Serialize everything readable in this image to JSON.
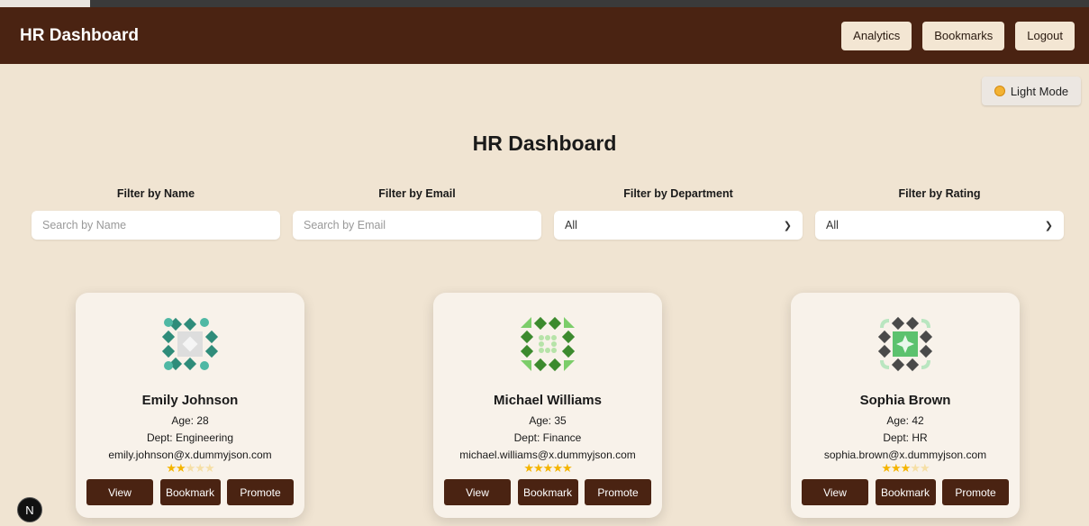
{
  "navbar": {
    "brand": "HR Dashboard",
    "analytics_label": "Analytics",
    "bookmarks_label": "Bookmarks",
    "logout_label": "Logout"
  },
  "theme_toggle": {
    "label": "Light Mode",
    "icon": "sun-icon"
  },
  "page_title": "HR Dashboard",
  "filters": {
    "name": {
      "label": "Filter by Name",
      "placeholder": "Search by Name"
    },
    "email": {
      "label": "Filter by Email",
      "placeholder": "Search by Email"
    },
    "department": {
      "label": "Filter by Department",
      "value": "All"
    },
    "rating": {
      "label": "Filter by Rating",
      "value": "All"
    }
  },
  "employees": [
    {
      "name": "Emily Johnson",
      "age": "Age: 28",
      "dept": "Dept: Engineering",
      "email": "emily.johnson@x.dummyjson.com",
      "rating": 2,
      "avatar_colors": [
        "#2f8c7a",
        "#4fb8a4",
        "#dddddd"
      ]
    },
    {
      "name": "Michael Williams",
      "age": "Age: 35",
      "dept": "Dept: Finance",
      "email": "michael.williams@x.dummyjson.com",
      "rating": 5,
      "avatar_colors": [
        "#3c8a2e",
        "#7ccd6a",
        "#b6e3a8"
      ]
    },
    {
      "name": "Sophia Brown",
      "age": "Age: 42",
      "dept": "Dept: HR",
      "email": "sophia.brown@x.dummyjson.com",
      "rating": 3,
      "avatar_colors": [
        "#4a4a4a",
        "#5cc26e",
        "#b9e6c0"
      ]
    }
  ],
  "card_actions": {
    "view": "View",
    "bookmark": "Bookmark",
    "promote": "Promote"
  },
  "badge": {
    "letter": "N"
  },
  "colors": {
    "brand": "#4a2312",
    "background": "#f0e4d2",
    "star": "#f4b400"
  }
}
